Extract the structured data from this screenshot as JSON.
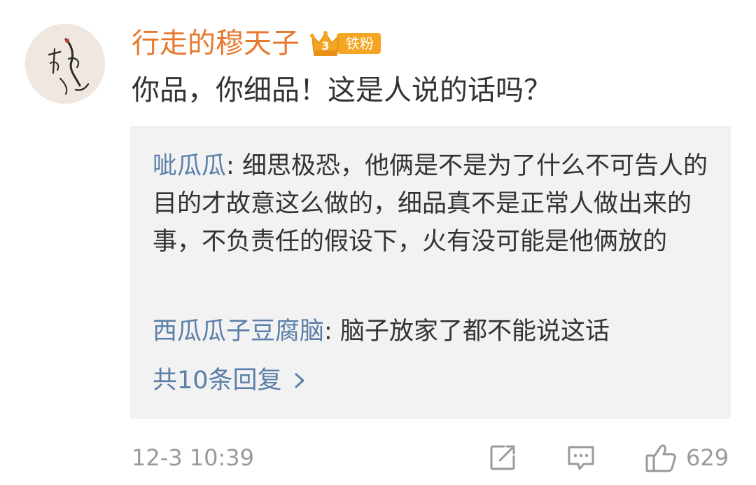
{
  "comment": {
    "username": "行走的穆天子",
    "fan_badge": {
      "level": "3",
      "label": "铁粉"
    },
    "text": "你品，你细品！这是人说的话吗？",
    "replies": [
      {
        "author": "呲瓜瓜",
        "separator": ": ",
        "text": "细思极恐，他俩是不是为了什么不可告人的目的才故意这么做的，细品真不是正常人做出来的事，不负责任的假设下，火有没可能是他俩放的"
      },
      {
        "author": "西瓜瓜子豆腐脑",
        "separator": ": ",
        "text": "脑子放家了都不能说这话"
      }
    ],
    "reply_count_label": "共10条回复",
    "timestamp": "12-3 10:39",
    "like_count": "629"
  },
  "colors": {
    "username": "#e8782c",
    "reply_author": "#5b7fa8",
    "reply_bg": "#f2f2f2",
    "muted": "#9a9a9a",
    "badge": "#f5a524"
  },
  "icons": {
    "avatar": "calligraphy-figure-avatar",
    "badge": "crown-icon",
    "chevron": "chevron-right-icon",
    "share": "share-icon",
    "comment": "comment-icon",
    "like": "thumbs-up-icon"
  }
}
